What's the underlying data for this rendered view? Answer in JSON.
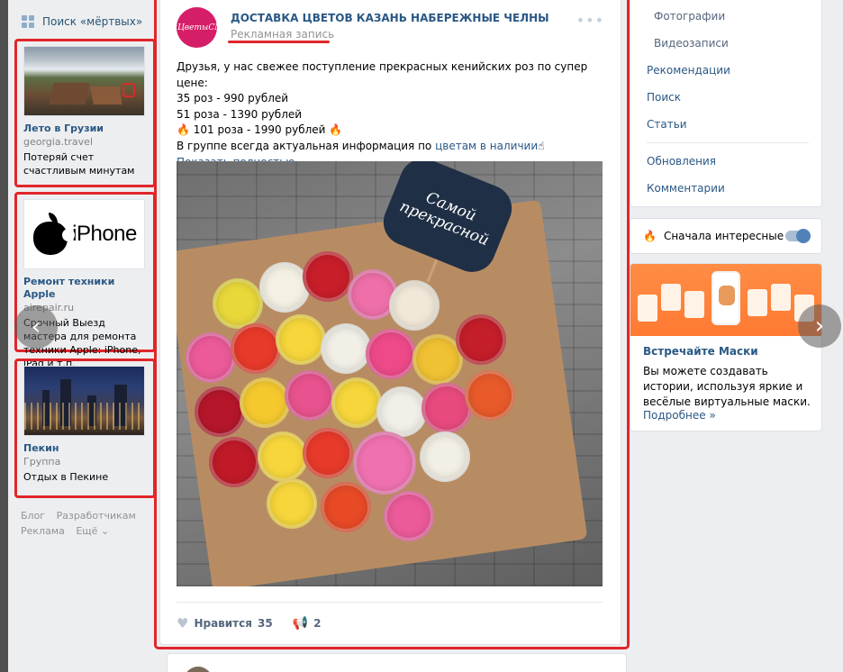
{
  "left": {
    "search_dead": "Поиск «мёртвых»",
    "ads": [
      {
        "title": "Лето в Грузии",
        "domain": "georgia.travel",
        "text": "Потеряй счет счастливым минутам"
      },
      {
        "title": "Ремонт техники Apple",
        "domain": "airepair.ru",
        "text": "Срочный Выезд мастера для ремонта техники Apple: iPhone, iPad и т.п.",
        "image_word": "iPhone"
      },
      {
        "title": "Пекин",
        "domain": "Группа",
        "text": "Отдых в Пекине"
      }
    ],
    "footer": {
      "blog": "Блог",
      "developers": "Разработчикам",
      "ads": "Реклама",
      "more": "Ещё ⌄"
    }
  },
  "post": {
    "avatar_text": "#ЦветыСМ",
    "author": "ДОСТАВКА ЦВЕТОВ КАЗАНЬ НАБЕРЕЖНЫЕ ЧЕЛНЫ",
    "sponsored": "Рекламная запись",
    "more": "•••",
    "lines": {
      "l1": "Друзья, у нас свежее поступление прекрасных кенийских роз по супер цене:",
      "l2": "35 роз - 990 рублей",
      "l3": "51 роза - 1390 рублей",
      "l4": "101 роза - 1990 рублей",
      "l5_pre": "В группе всегда актуальная информация по ",
      "l5_link": "цветам в наличии",
      "l5_emoji": "☝"
    },
    "fire": "🔥",
    "show_more": "Показать полностью…",
    "photo_sign": "Самой прекрасной",
    "likes_label": "Нравится",
    "likes_count": "35",
    "shares_count": "2"
  },
  "right": {
    "menu": {
      "photos": "Фотографии",
      "videos": "Видеозаписи",
      "recommendations": "Рекомендации",
      "search": "Поиск",
      "articles": "Статьи",
      "updates": "Обновления",
      "comments": "Комментарии"
    },
    "sort_label": "Сначала интересные",
    "promo": {
      "title": "Встречайте Маски",
      "text": "Вы можете создавать истории, используя яркие и весёлые виртуальные маски.",
      "link": "Подробнее »"
    }
  },
  "colors": {
    "accent": "#2a5885",
    "highlight": "#e0262a",
    "brand_avatar": "#d61e68"
  }
}
